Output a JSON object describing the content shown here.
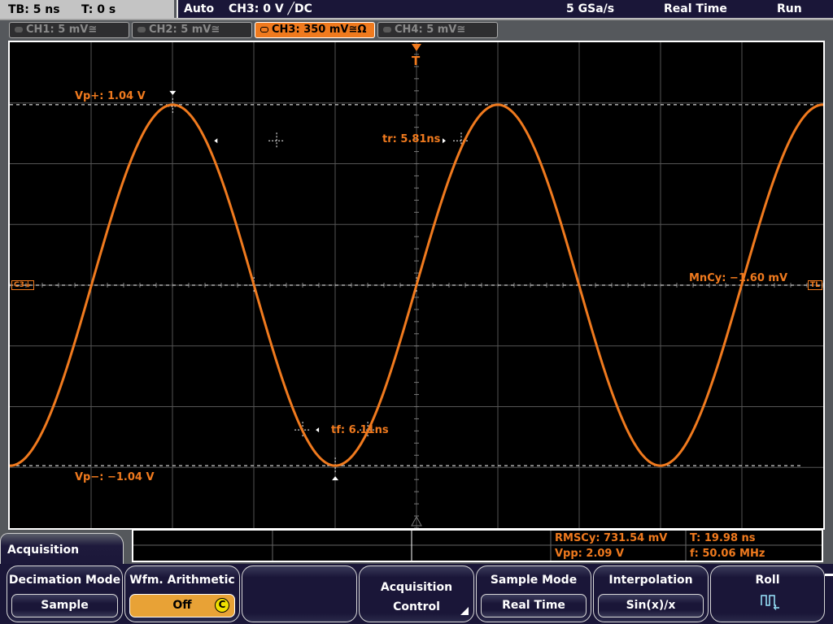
{
  "topbar": {
    "timebase": "TB: 5 ns",
    "trigger_time": "T: 0 s",
    "trigger_mode": "Auto",
    "trigger_source": "CH3: 0 V ╱DC",
    "sample_rate": "5 GSa/s",
    "acq_mode": "Real Time",
    "run_state": "Run"
  },
  "channels": [
    {
      "label": "CH1: 5 mV≅",
      "active": false
    },
    {
      "label": "CH2: 5 mV≅",
      "active": false
    },
    {
      "label": "CH3: 350 mV≅Ω",
      "active": true
    },
    {
      "label": "CH4: 5 mV≅",
      "active": false
    }
  ],
  "waveform": {
    "channel": "CH3",
    "color": "#f07a1e",
    "frequency_MHz": 50.06,
    "period_ns": 19.98,
    "amplitude_V": 1.04,
    "volts_per_div": 0.35,
    "time_per_div_ns": 5,
    "h_divisions": 10,
    "v_divisions": 8
  },
  "markers": {
    "trigger_marker": "T",
    "ground_marker": "C3⏚",
    "trigger_level_marker": "TL"
  },
  "measurements_on_screen": {
    "vp_plus": "Vp+: 1.04 V",
    "vp_minus": "Vp−: −1.04 V",
    "rise_time": "tr: 5.81ns",
    "fall_time": "tf: 6.11ns",
    "mean_cycle": "MnCy: −1.60 mV"
  },
  "measurement_table": {
    "rms_cycle": "RMSCy: 731.54 mV",
    "period": "T: 19.98 ns",
    "vpp": "Vpp: 2.09 V",
    "frequency": "f: 50.06 MHz"
  },
  "menu": {
    "title": "Acquisition",
    "softkeys": [
      {
        "title": "Decimation Mode",
        "value": "Sample"
      },
      {
        "title": "Wfm. Arithmetic",
        "value": "Off",
        "highlight": true
      },
      {
        "title": "",
        "value": ""
      },
      {
        "title": "Acquisition",
        "subtitle": "Control"
      },
      {
        "title": "Sample Mode",
        "value": "Real Time"
      },
      {
        "title": "Interpolation",
        "value": "Sin(x)/x"
      },
      {
        "title": "Roll",
        "icon": "roll-icon"
      }
    ]
  }
}
